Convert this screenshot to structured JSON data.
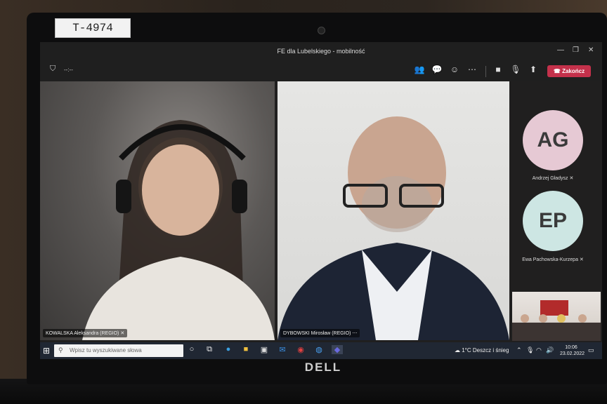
{
  "device": {
    "tag_label": "T-4974",
    "brand_logo": "DELL"
  },
  "window": {
    "title": "FE dla Lubelskiego - mobilność",
    "controls": {
      "minimize": "—",
      "maximize": "❐",
      "close": "✕"
    }
  },
  "toolbar": {
    "call_timer": "--:--",
    "icons": [
      "people-icon",
      "chat-icon",
      "reactions-icon",
      "more-icon",
      "camera-icon",
      "mic-icon",
      "share-icon"
    ],
    "leave_label": "Zakończ",
    "leave_color": "#c4314b"
  },
  "participants": {
    "video": [
      {
        "name": "KOWALSKA Aleksandra (REGIO)"
      },
      {
        "name": "DYBOWSKI Mirosław (REGIO)"
      }
    ],
    "avatars": [
      {
        "initials": "AG",
        "name": "Andrzej Gładysz",
        "color": "#e6c9d4"
      },
      {
        "initials": "EP",
        "name": "Ewa Pachowska-Kurzepa",
        "color": "#cde6e3"
      }
    ]
  },
  "taskbar": {
    "search_placeholder": "Wpisz tu wyszukiwane słowa",
    "weather": "1°C  Deszcz i śnieg",
    "time": "10:06",
    "date": "23.02.2022"
  }
}
